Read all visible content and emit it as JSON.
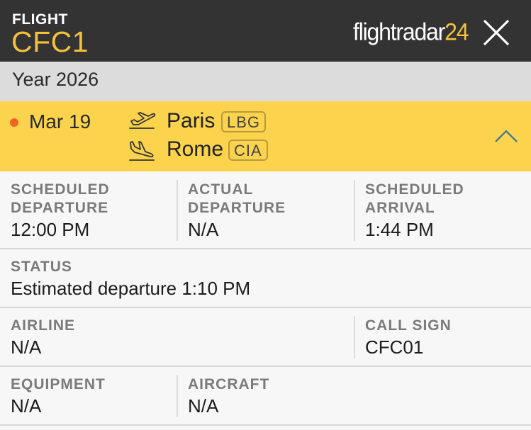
{
  "header": {
    "label": "FLIGHT",
    "flight_number": "CFC1",
    "brand_main": "flightradar",
    "brand_num": "24",
    "close_icon": "close-icon",
    "colors": {
      "bar": "#333333",
      "accent": "#f5c13a"
    }
  },
  "year_bar": {
    "text": "Year 2026"
  },
  "route": {
    "date": "Mar 19",
    "status_dot_color": "#f06424",
    "departure": {
      "city": "Paris",
      "code": "LBG",
      "icon": "takeoff-icon"
    },
    "arrival": {
      "city": "Rome",
      "code": "CIA",
      "icon": "landing-icon"
    },
    "toggle_icon": "chevron-up-icon",
    "background": "#fcd34d"
  },
  "details": {
    "scheduled_departure": {
      "caption_line1": "SCHEDULED",
      "caption_line2": "DEPARTURE",
      "value": "12:00 PM"
    },
    "actual_departure": {
      "caption_line1": "ACTUAL",
      "caption_line2": "DEPARTURE",
      "value": "N/A"
    },
    "scheduled_arrival": {
      "caption_line1": "SCHEDULED",
      "caption_line2": "ARRIVAL",
      "value": "1:44 PM"
    },
    "status": {
      "caption": "STATUS",
      "value": "Estimated departure 1:10 PM"
    },
    "airline": {
      "caption": "AIRLINE",
      "value": "N/A"
    },
    "call_sign": {
      "caption": "CALL SIGN",
      "value": "CFC01"
    },
    "equipment": {
      "caption": "EQUIPMENT",
      "value": "N/A"
    },
    "aircraft": {
      "caption": "AIRCRAFT",
      "value": "N/A"
    }
  }
}
